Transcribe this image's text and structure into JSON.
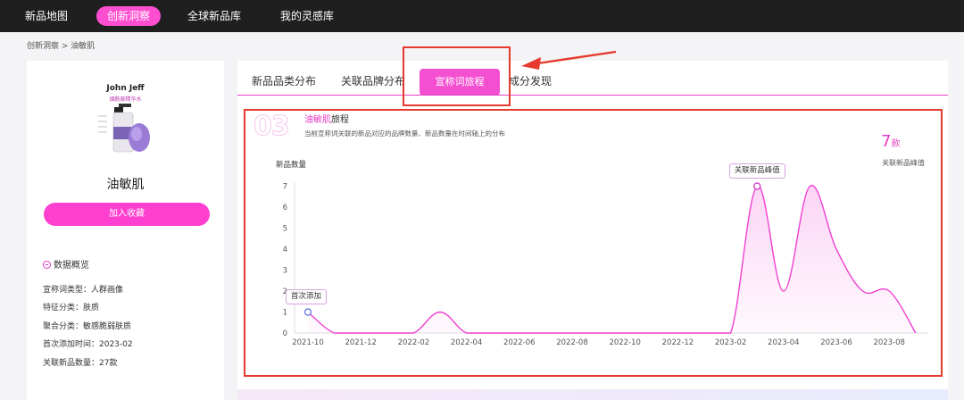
{
  "nav": {
    "items": [
      {
        "label": "新品地图",
        "active": false
      },
      {
        "label": "创新洞察",
        "active": true
      },
      {
        "label": "全球新品库",
        "active": false
      },
      {
        "label": "我的灵感库",
        "active": false
      }
    ]
  },
  "breadcrumb": {
    "text": "创新洞察 > 油敏肌"
  },
  "product": {
    "brand": "John Jeff",
    "brand_sub": "烟酰胺精华水",
    "name": "油敏肌",
    "fav_button": "加入收藏"
  },
  "overview": {
    "title": "数据概览",
    "lines": [
      "宣称词类型：人群画像",
      "特征分类：肤质",
      "聚合分类：敏感脆弱肤质",
      "首次添加时间：2023-02",
      "关联新品数量：27款"
    ]
  },
  "tabs": {
    "items": [
      {
        "label": "新品品类分布"
      },
      {
        "label": "关联品牌分布"
      },
      {
        "label": "宣称词旅程"
      },
      {
        "label": "成分发现"
      }
    ],
    "active_index": 2
  },
  "section": {
    "number": "03",
    "title_highlight": "油敏肌",
    "title_rest": "旅程",
    "description": "当前宣称词关联的新品对应的品牌数量、新品数量在时间轴上的分布"
  },
  "peak": {
    "value": "7",
    "unit": "款",
    "label": "关联新品峰值"
  },
  "chart_data": {
    "type": "area",
    "ylabel": "新品数量",
    "ylim": [
      0,
      7
    ],
    "yticks": [
      0,
      1,
      2,
      3,
      4,
      5,
      6,
      7
    ],
    "xlabels": [
      "2021-10",
      "2021-12",
      "2022-02",
      "2022-04",
      "2022-06",
      "2022-08",
      "2022-10",
      "2022-12",
      "2023-02",
      "2023-04",
      "2023-06",
      "2023-08"
    ],
    "x_months": [
      "2021-10",
      "2021-11",
      "2021-12",
      "2022-01",
      "2022-02",
      "2022-03",
      "2022-04",
      "2022-05",
      "2022-06",
      "2022-07",
      "2022-08",
      "2022-09",
      "2022-10",
      "2022-11",
      "2022-12",
      "2023-01",
      "2023-02",
      "2023-03",
      "2023-04",
      "2023-05",
      "2023-06",
      "2023-07",
      "2023-08",
      "2023-09"
    ],
    "values": [
      1,
      0,
      0,
      0,
      0,
      1,
      0,
      0,
      0,
      0,
      0,
      0,
      0,
      0,
      0,
      0,
      0,
      7,
      2,
      7,
      4,
      2,
      2,
      0
    ],
    "annotations": [
      {
        "label": "首次添加",
        "month": "2021-10",
        "value": 1
      },
      {
        "label": "关联新品峰值",
        "month": "2023-03",
        "value": 7
      }
    ],
    "color": "#f040d0"
  },
  "colors": {
    "accent": "#ff4fd1",
    "highlight_box": "#e53a2d"
  }
}
